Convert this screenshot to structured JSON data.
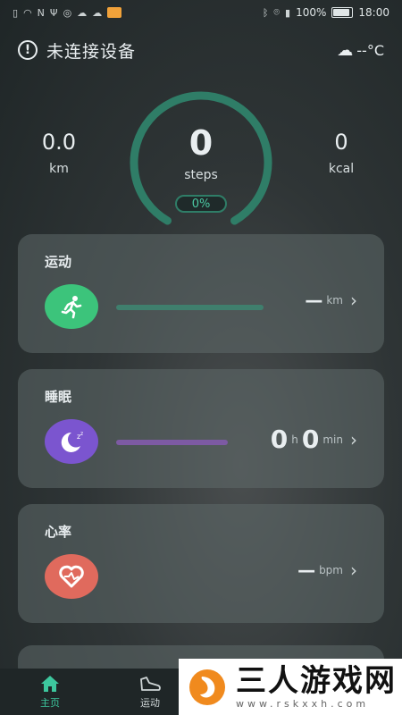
{
  "status_bar": {
    "battery_text": "100%",
    "time": "18:00"
  },
  "header": {
    "title": "未连接设备",
    "weather_text": "--°C"
  },
  "stats": {
    "distance": {
      "value": "0.0",
      "unit": "km"
    },
    "steps": {
      "value": "0",
      "unit": "steps",
      "progress_text": "0%",
      "progress": 0
    },
    "calories": {
      "value": "0",
      "unit": "kcal"
    }
  },
  "cards": {
    "sport": {
      "title": "运动",
      "value": "—",
      "unit": "km",
      "icon": "running-person-icon",
      "color": "#3cc47b"
    },
    "sleep": {
      "title": "睡眠",
      "hours": "0",
      "hours_unit": "h",
      "minutes": "0",
      "minutes_unit": "min",
      "icon": "moon-icon",
      "color": "#7b55cf"
    },
    "heart": {
      "title": "心率",
      "value": "—",
      "unit": "bpm",
      "icon": "heart-icon",
      "color": "#e06a5d"
    }
  },
  "tabs": [
    {
      "label": "主页",
      "icon": "home-icon",
      "active": true
    },
    {
      "label": "运动",
      "icon": "shoe-icon",
      "active": false
    }
  ],
  "watermark": {
    "name": "三人游戏网",
    "url": "www.rskxxh.com"
  },
  "colors": {
    "accent": "#3dc79e",
    "ring": "#2f7d67"
  }
}
